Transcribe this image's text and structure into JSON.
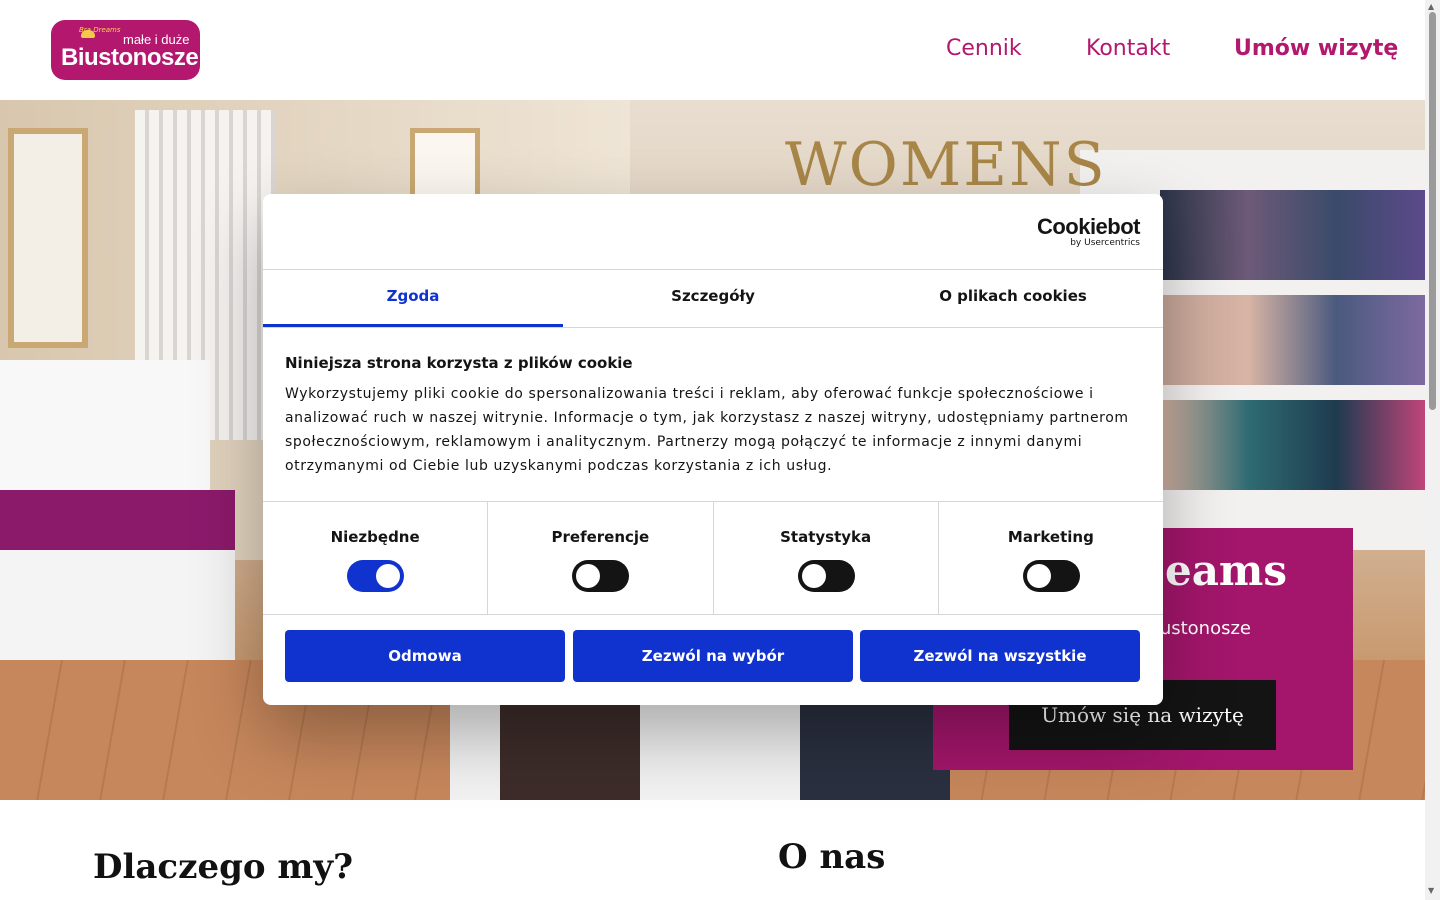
{
  "header": {
    "logo": {
      "mini": "Bra Dreams",
      "tagline": "małe i duże",
      "name": "Biustonosze"
    },
    "nav": {
      "cennik": "Cennik",
      "kontakt": "Kontakt",
      "umow": "Umów wizytę"
    }
  },
  "hero": {
    "background_sign": "WOMENS",
    "promo": {
      "title": "eams",
      "subtitle": "ustonosze",
      "button": "Umów się na wizytę"
    }
  },
  "sections": {
    "left_title": "Dlaczego my?",
    "right_title": "O nas"
  },
  "cookie_dialog": {
    "brand": "Cookiebot",
    "brand_sub": "by Usercentrics",
    "tabs": [
      "Zgoda",
      "Szczegóły",
      "O plikach cookies"
    ],
    "active_tab": "Zgoda",
    "title": "Niniejsza strona korzysta z plików cookie",
    "text": "Wykorzystujemy pliki cookie do spersonalizowania treści i reklam, aby oferować funkcje społecznościowe i analizować ruch w naszej witrynie. Informacje o tym, jak korzystasz z naszej witryny, udostępniamy partnerom społecznościowym, reklamowym i analitycznym. Partnerzy mogą połączyć te informacje z innymi danymi otrzymanymi od Ciebie lub uzyskanymi podczas korzystania z ich usług.",
    "toggles": [
      {
        "label": "Niezbędne",
        "on": true
      },
      {
        "label": "Preferencje",
        "on": false
      },
      {
        "label": "Statystyka",
        "on": false
      },
      {
        "label": "Marketing",
        "on": false
      }
    ],
    "buttons": {
      "deny": "Odmowa",
      "allow_selection": "Zezwól na wybór",
      "allow_all": "Zezwól na wszystkie"
    }
  },
  "colors": {
    "brand": "#b3186e",
    "promo": "#a3166b",
    "cookie_accent": "#1032cf"
  }
}
